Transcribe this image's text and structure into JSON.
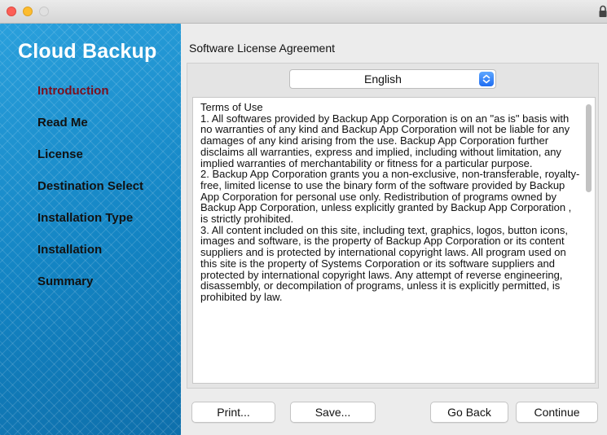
{
  "brand": {
    "title": "Cloud Backup",
    "accent_color": "#1587c6"
  },
  "steps": [
    {
      "label": "Introduction",
      "active": true
    },
    {
      "label": "Read Me"
    },
    {
      "label": "License"
    },
    {
      "label": "Destination Select"
    },
    {
      "label": "Installation Type"
    },
    {
      "label": "Installation"
    },
    {
      "label": "Summary"
    }
  ],
  "main": {
    "heading": "Software License Agreement",
    "language": {
      "selected": "English",
      "icon": "updown-stepper-icon"
    },
    "license_paragraphs": [
      "Terms of Use",
      "1. All softwares provided by  Backup App  Corporation is on an \"as is\" basis with no warranties of any kind and Backup App Corporation will not be liable for any damages of any kind arising from the use.  Backup App Corporation further disclaims all warranties, express and implied, including without limitation, any implied warranties of merchantability or fitness for a particular purpose.",
      "2.  Backup App Corporation grants you a non-exclusive, non-transferable, royalty-free, limited license to use the binary form of the software provided by  Backup App Corporation for personal use only. Redistribution of programs owned by Backup App Corporation, unless explicitly granted by  Backup App Corporation , is strictly prohibited.",
      "3. All content included on this site, including text, graphics, logos, button icons, images and software, is the property of Backup App Corporation or its content suppliers and is protected by international copyright laws. All program used on this site is the property of Systems Corporation or its software suppliers and protected by international copyright laws. Any attempt of reverse engineering, disassembly, or decompilation of programs, unless it is explicitly permitted, is prohibited by law."
    ]
  },
  "buttons": {
    "print": "Print...",
    "save": "Save...",
    "go_back": "Go Back",
    "continue": "Continue"
  }
}
